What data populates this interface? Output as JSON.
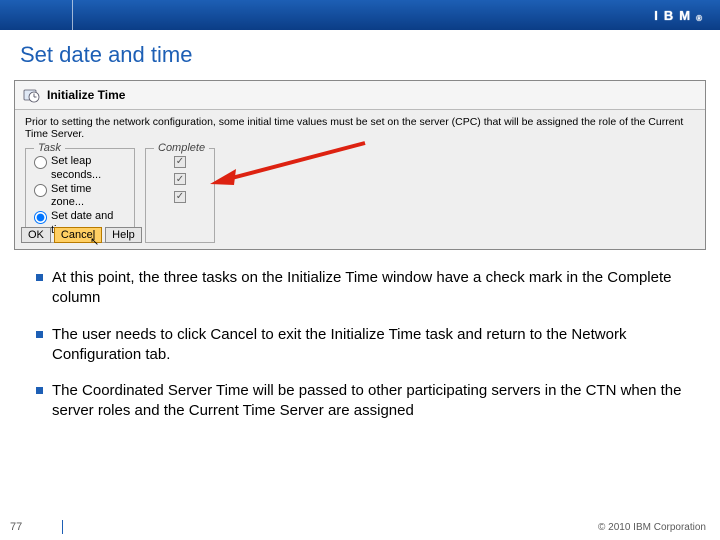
{
  "header": {
    "logo_text": "IBM",
    "logo_reg": "®"
  },
  "slide": {
    "title": "Set date and time"
  },
  "screenshot": {
    "window_title": "Initialize Time",
    "description": "Prior to setting the network configuration, some initial time values must be set on the server (CPC) that will be assigned the role of the Current Time Server.",
    "task_legend": "Task",
    "complete_legend": "Complete",
    "task_1": "Set leap seconds...",
    "task_2": "Set time zone...",
    "task_3": "Set date and time...",
    "btn_ok": "OK",
    "btn_cancel": "Cancel",
    "btn_help": "Help"
  },
  "bullets": {
    "b1": "At this point, the three tasks on the Initialize Time window have a check mark in the Complete column",
    "b2": "The user needs to click Cancel to exit the Initialize Time task and return to the Network Configuration tab.",
    "b3": "The Coordinated Server Time will be passed to other participating servers in the CTN when the server roles and the Current Time Server are assigned"
  },
  "footer": {
    "page_number": "77",
    "copyright": "© 2010 IBM Corporation"
  }
}
